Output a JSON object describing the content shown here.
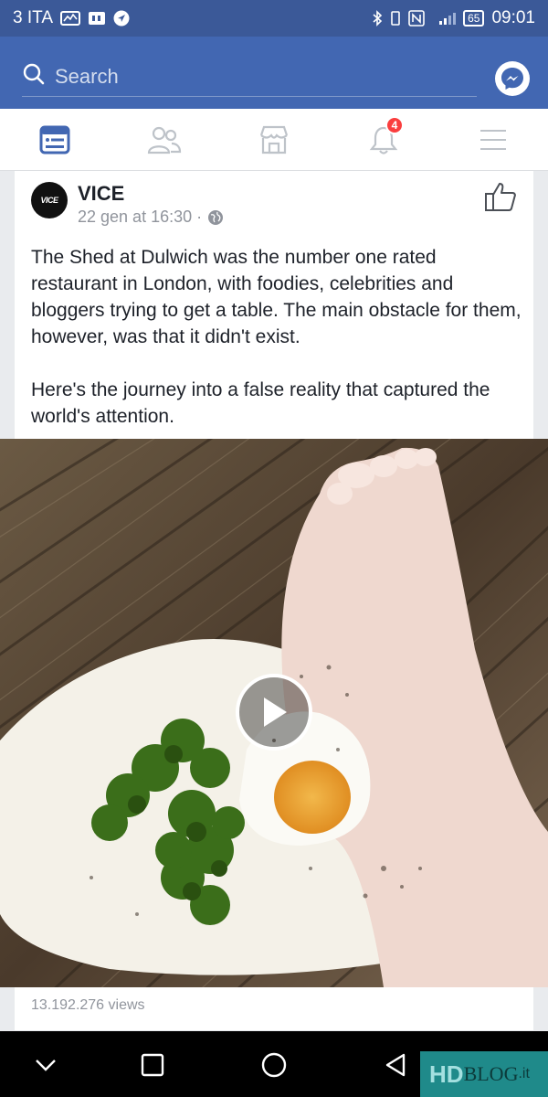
{
  "status_bar": {
    "carrier": "3 ITA",
    "battery": "65",
    "time": "09:01"
  },
  "search": {
    "placeholder": "Search"
  },
  "nav": {
    "tabs": [
      {
        "name": "news-feed",
        "icon": "news-feed-icon",
        "active": true
      },
      {
        "name": "friends",
        "icon": "friends-icon",
        "active": false
      },
      {
        "name": "marketplace",
        "icon": "marketplace-icon",
        "active": false
      },
      {
        "name": "notifications",
        "icon": "bell-icon",
        "active": false,
        "badge": "4"
      },
      {
        "name": "menu",
        "icon": "hamburger-menu-icon",
        "active": false
      }
    ]
  },
  "post": {
    "avatar_text": "VICE",
    "author": "VICE",
    "timestamp": "22 gen at 16:30 ·",
    "paragraphs": [
      "The Shed at Dulwich was the number one rated restaurant in London, with foodies, celebrities and bloggers trying to get a table. The main obstacle for them, however, was that it didn't exist.",
      "Here's the journey into a false reality that captured the world's attention."
    ],
    "views": "13.192.276 views"
  },
  "watermark": {
    "hd": "HD",
    "blog": "BLOG",
    "tld": ".it"
  },
  "colors": {
    "brand": "#4267b2",
    "status_bar": "#3b5998",
    "active_tab": "#4267b2",
    "badge": "#fa3e3e"
  }
}
